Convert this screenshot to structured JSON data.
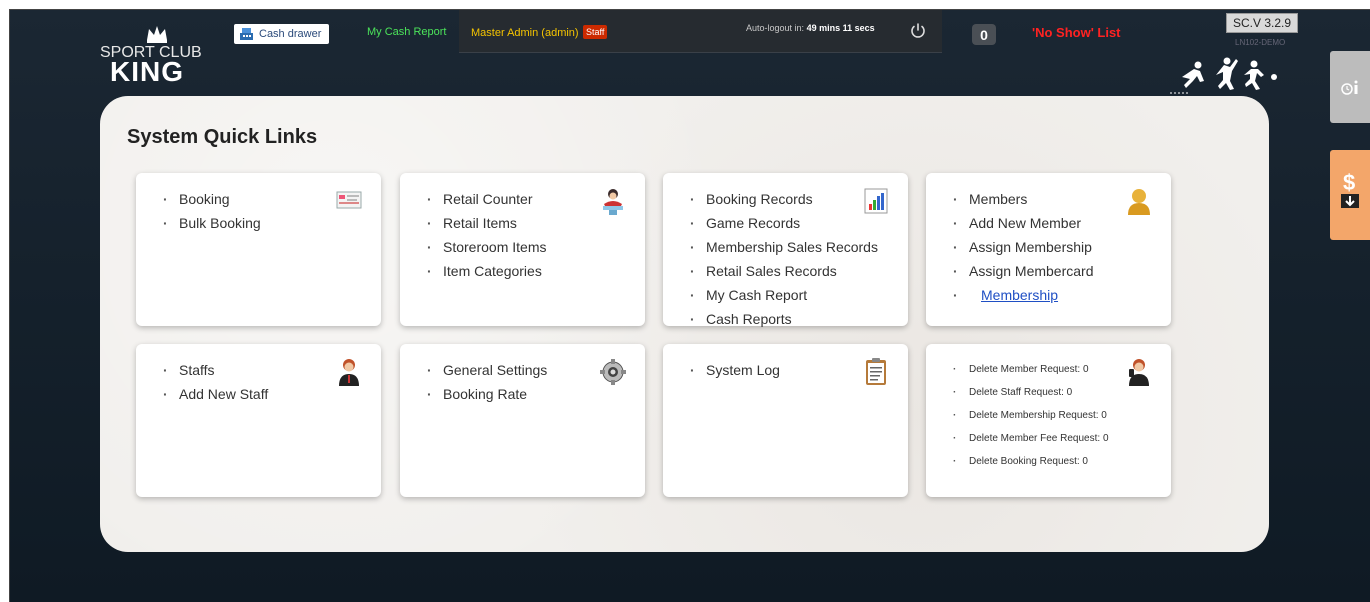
{
  "logo": {
    "line1": "SPORT CLUB",
    "line2": "KING"
  },
  "topbar": {
    "cash_drawer": "Cash drawer",
    "my_cash_report": "My Cash Report",
    "admin_name": "Master Admin (admin)",
    "staff_badge": "Staff",
    "autologout_label": "Auto-logout in:",
    "autologout_time": "49 mins 11 secs",
    "notification_count": "0",
    "no_show": "'No Show' List",
    "version": "SC.V 3.2.9",
    "version_sub": "LN102-DEMO"
  },
  "colors": {
    "accent_green": "#4be35a",
    "accent_red": "#ff2222",
    "admin_yellow": "#f5c400",
    "side_tab_orange": "#f3a66a"
  },
  "panel": {
    "title": "System Quick Links"
  },
  "cards": [
    {
      "icon": "booking-sheet-icon",
      "items": [
        "Booking",
        "Bulk Booking"
      ]
    },
    {
      "icon": "retail-person-icon",
      "items": [
        "Retail Counter",
        "Retail Items",
        "Storeroom Items",
        "Item Categories"
      ]
    },
    {
      "icon": "bar-chart-icon",
      "items": [
        "Booking Records",
        "Game Records",
        "Membership Sales Records",
        "Retail Sales Records",
        "My Cash Report",
        "Cash Reports"
      ]
    },
    {
      "icon": "member-user-icon",
      "items": [
        "Members",
        "Add New Member",
        "Assign Membership",
        "Assign Membercard"
      ],
      "link": "Membership"
    },
    {
      "icon": "staff-person-icon",
      "items": [
        "Staffs",
        "Add New Staff"
      ]
    },
    {
      "icon": "gear-icon",
      "items": [
        "General Settings",
        "Booking Rate"
      ]
    },
    {
      "icon": "clipboard-icon",
      "items": [
        "System Log"
      ]
    },
    {
      "icon": "requests-person-icon",
      "items": [
        "Delete Member Request: 0",
        "Delete Staff Request: 0",
        "Delete Membership Request: 0",
        "Delete Member Fee Request: 0",
        "Delete Booking Request: 0"
      ]
    }
  ]
}
